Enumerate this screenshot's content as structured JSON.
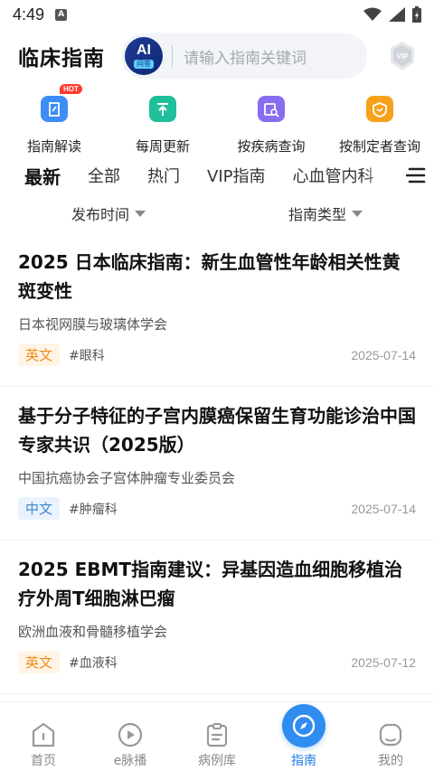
{
  "status_bar": {
    "time": "4:49"
  },
  "header": {
    "title": "临床指南",
    "ai_badge": {
      "main": "AI",
      "sub": "问答"
    },
    "search_placeholder": "请输入指南关键词",
    "vip_label": "VIP"
  },
  "quick_entries": [
    {
      "label": "指南解读",
      "icon": "book-icon",
      "color": "#3d8df5",
      "badge": "HOT"
    },
    {
      "label": "每周更新",
      "icon": "upload-icon",
      "color": "#1fbf9b"
    },
    {
      "label": "按疾病查询",
      "icon": "search-doc-icon",
      "color": "#8a6cf0"
    },
    {
      "label": "按制定者查询",
      "icon": "shield-icon",
      "color": "#f7a11a"
    }
  ],
  "tabs": [
    "最新",
    "全部",
    "热门",
    "VIP指南",
    "心血管内科"
  ],
  "active_tab": "最新",
  "filters": [
    "发布时间",
    "指南类型"
  ],
  "guidelines": [
    {
      "title": "2025 日本临床指南：新生血管性年龄相关性黄斑变性",
      "org": "日本视网膜与玻璃体学会",
      "lang": "英文",
      "lang_type": "en",
      "tag": "#眼科",
      "date": "2025-07-14"
    },
    {
      "title": "基于分子特征的子宫内膜癌保留生育功能诊治中国专家共识（2025版）",
      "org": "中国抗癌协会子宫体肿瘤专业委员会",
      "lang": "中文",
      "lang_type": "zh",
      "tag": "#肿瘤科",
      "date": "2025-07-14"
    },
    {
      "title": "2025 EBMT指南建议：异基因造血细胞移植治疗外周T细胞淋巴瘤",
      "org": "欧洲血液和骨髓移植学会",
      "lang": "英文",
      "lang_type": "en",
      "tag": "#血液科",
      "date": "2025-07-12"
    }
  ],
  "bottom_nav": [
    {
      "label": "首页",
      "icon": "home-icon"
    },
    {
      "label": "e脉播",
      "icon": "play-icon"
    },
    {
      "label": "病例库",
      "icon": "clipboard-icon"
    },
    {
      "label": "指南",
      "icon": "compass-icon",
      "active": true
    },
    {
      "label": "我的",
      "icon": "user-icon"
    }
  ],
  "colors": {
    "accent": "#1e7be6",
    "lang_en": "#f28a1a",
    "lang_zh": "#3b86d6"
  }
}
